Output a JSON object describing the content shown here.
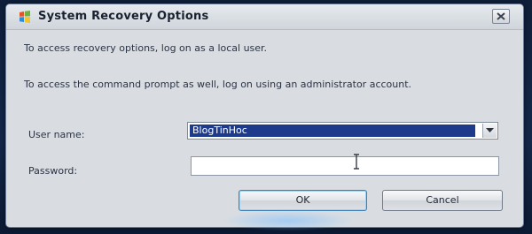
{
  "window": {
    "title": "System Recovery Options",
    "close_icon": "close-icon",
    "app_icon": "windows-flag-icon"
  },
  "message": {
    "line1": "To access recovery options, log on as a local user.",
    "line2": "To access the command prompt as well, log on using an administrator account."
  },
  "form": {
    "username_label": "User name:",
    "username_value": "BlogTinHoc",
    "password_label": "Password:",
    "password_value": ""
  },
  "buttons": {
    "ok_label": "OK",
    "cancel_label": "Cancel"
  },
  "colors": {
    "selection": "#1d3b8a",
    "dialog_bg": "#d9dde2",
    "desktop_bg": "#10203c"
  }
}
